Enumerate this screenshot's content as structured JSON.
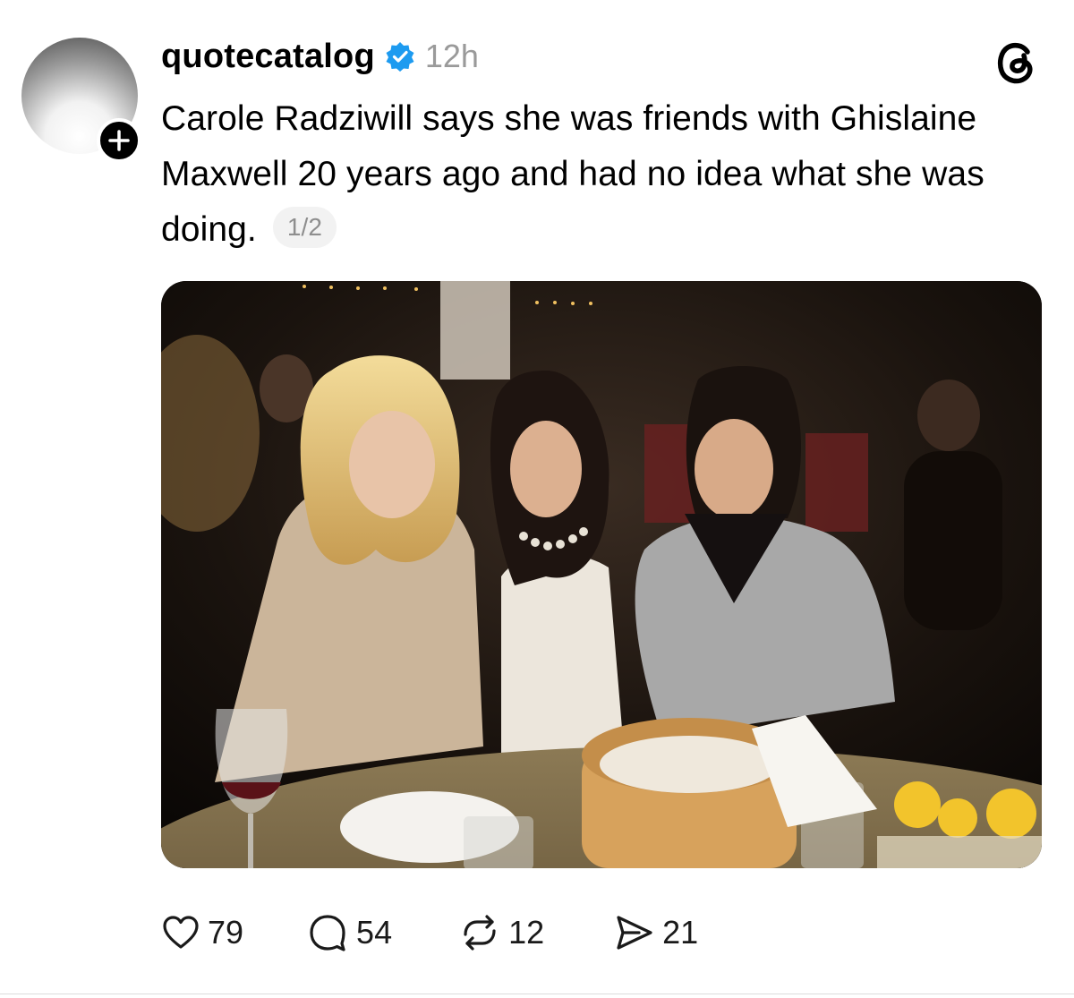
{
  "post": {
    "username": "quotecatalog",
    "timestamp": "12h",
    "text": "Carole Radziwill says she was friends with Ghislaine Maxwell 20 years ago and had no idea what she was doing.",
    "thread_counter": "1/2"
  },
  "icons": {
    "avatar": "profile-avatar",
    "follow": "plus-icon",
    "verified": "verified-badge-icon",
    "app_logo": "threads-logo-icon",
    "like": "heart-icon",
    "reply": "speech-bubble-icon",
    "repost": "repost-arrows-icon",
    "share": "send-icon"
  },
  "stats": {
    "likes": "79",
    "replies": "54",
    "reposts": "12",
    "shares": "21"
  },
  "colors": {
    "verified": "#1d9bf0",
    "text": "#000000",
    "muted": "#9a9a9a"
  }
}
